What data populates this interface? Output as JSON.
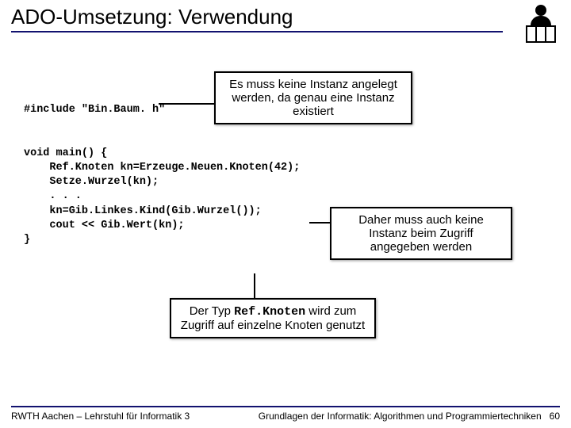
{
  "title": "ADO-Umsetzung: Verwendung",
  "callouts": {
    "c1": "Es muss keine Instanz angelegt werden, da genau eine Instanz existiert",
    "c2": "Daher muss auch keine Instanz beim Zugriff angegeben werden",
    "c3_pre": "Der Typ ",
    "c3_mono": "Ref.Knoten",
    "c3_post": " wird zum Zugriff auf einzelne Knoten genutzt"
  },
  "code": {
    "l1": "#include \"Bin.Baum. h\"",
    "l2": "void main() {",
    "l3": "    Ref.Knoten kn=Erzeuge.Neuen.Knoten(42);",
    "l4": "    Setze.Wurzel(kn);",
    "l5": "    . . .",
    "l6": "    kn=Gib.Linkes.Kind(Gib.Wurzel());",
    "l7": "    cout << Gib.Wert(kn);",
    "l8": "}"
  },
  "footer": {
    "left": "RWTH Aachen – Lehrstuhl für Informatik 3",
    "right": "Grundlagen der Informatik: Algorithmen und Programmiertechniken",
    "page": "60"
  }
}
